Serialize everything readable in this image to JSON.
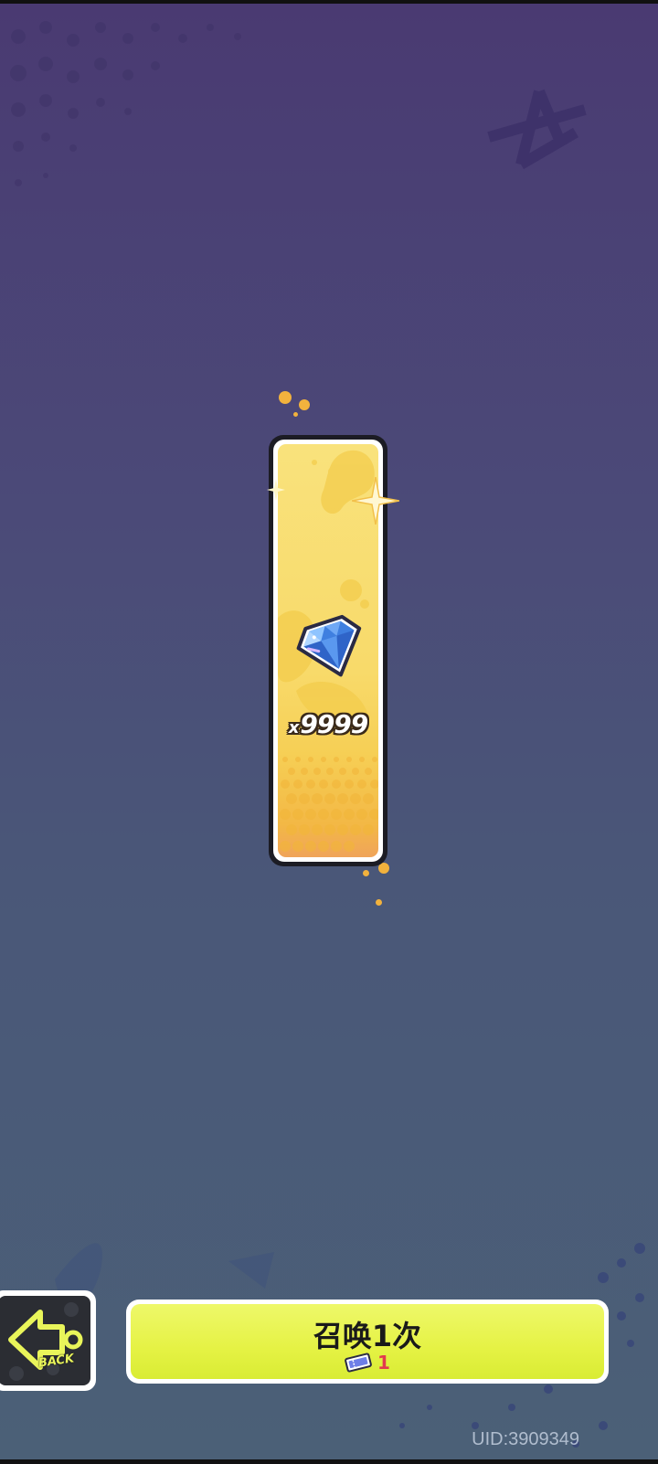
{
  "reward": {
    "item_icon": "diamond-gem-icon",
    "quantity_prefix": "x",
    "quantity": "9999"
  },
  "back_button": {
    "icon": "back-arrow-icon",
    "label": "BACK"
  },
  "summon_button": {
    "label": "召唤1次",
    "cost_icon": "summon-ticket-icon",
    "cost_value": "1"
  },
  "footer": {
    "uid": "UID:3909349"
  },
  "colors": {
    "background_top": "#4a3a72",
    "background_bottom": "#4b6077",
    "card_yellow": "#f9e27c",
    "button_lime": "#e5f244",
    "cost_red": "#e23a4e",
    "back_label": "#e9f55a"
  }
}
